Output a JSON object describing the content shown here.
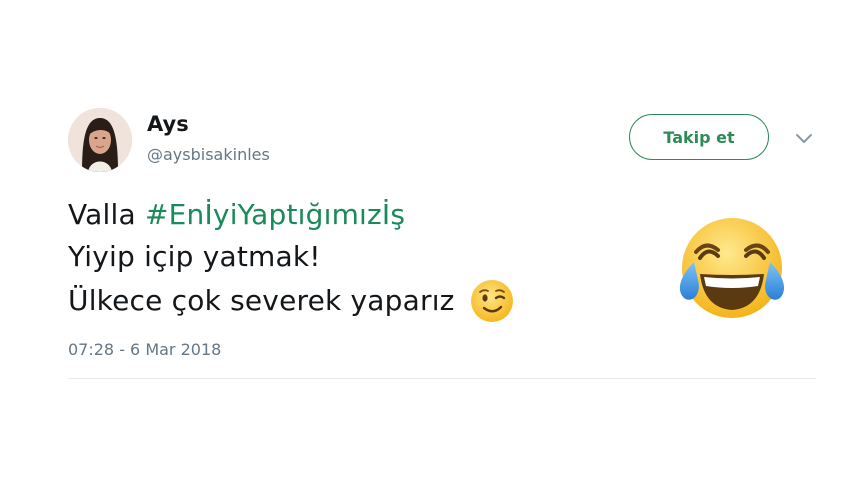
{
  "user": {
    "name": "Ays",
    "handle": "@aysbisakinles"
  },
  "follow_button": {
    "label": "Takip et"
  },
  "tweet": {
    "prefix": "Valla ",
    "hashtag": "#EnİyiYaptığımızİş",
    "line2": "Yiyip içip yatmak!",
    "line3": "Ülkece çok severek yaparız",
    "timestamp": "07:28 - 6 Mar 2018"
  },
  "icons": {
    "caret": "chevron-down-icon",
    "inline_emoji": "winking-face-icon",
    "side_emoji": "face-with-tears-of-joy-icon",
    "avatar": "profile-photo"
  },
  "colors": {
    "hashtag": "#1a8a5a",
    "follow_border": "#2e8b57",
    "text": "#14171a",
    "secondary": "#657786"
  }
}
